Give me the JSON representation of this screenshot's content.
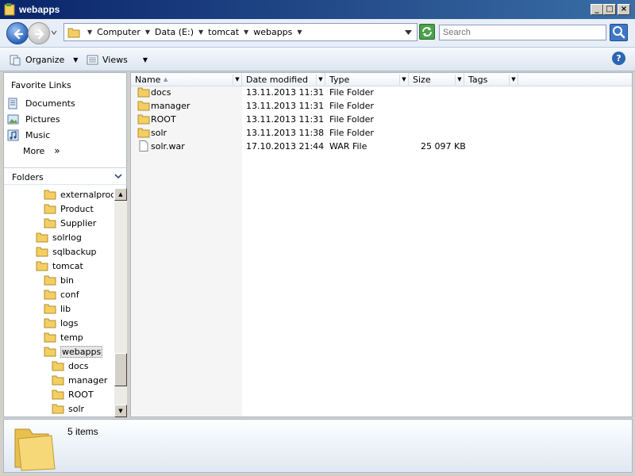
{
  "window": {
    "title": "webapps"
  },
  "address": {
    "crumbs": [
      "Computer",
      "Data (E:)",
      "tomcat",
      "webapps"
    ]
  },
  "search": {
    "placeholder": "Search"
  },
  "toolbar": {
    "organize_label": "Organize",
    "views_label": "Views"
  },
  "nav": {
    "favorites_title": "Favorite Links",
    "favorites": [
      {
        "label": "Documents",
        "icon": "documents-icon"
      },
      {
        "label": "Pictures",
        "icon": "pictures-icon"
      },
      {
        "label": "Music",
        "icon": "music-icon"
      },
      {
        "label": "More",
        "icon": "more-chevron-icon"
      }
    ],
    "folders_label": "Folders",
    "tree": [
      {
        "label": "externalprodu",
        "selected": false
      },
      {
        "label": "Product",
        "selected": false
      },
      {
        "label": "Supplier",
        "selected": false
      },
      {
        "label": "solrlog",
        "selected": false
      },
      {
        "label": "sqlbackup",
        "selected": false
      },
      {
        "label": "tomcat",
        "selected": false
      },
      {
        "label": "bin",
        "selected": false
      },
      {
        "label": "conf",
        "selected": false
      },
      {
        "label": "lib",
        "selected": false
      },
      {
        "label": "logs",
        "selected": false
      },
      {
        "label": "temp",
        "selected": false
      },
      {
        "label": "webapps",
        "selected": true
      },
      {
        "label": "docs",
        "selected": false
      },
      {
        "label": "manager",
        "selected": false
      },
      {
        "label": "ROOT",
        "selected": false
      },
      {
        "label": "solr",
        "selected": false
      }
    ]
  },
  "columns": {
    "name": "Name",
    "date": "Date modified",
    "type": "Type",
    "size": "Size",
    "tags": "Tags"
  },
  "files": [
    {
      "name": "docs",
      "date": "13.11.2013 11:31",
      "type": "File Folder",
      "size": "",
      "icon": "folder-icon"
    },
    {
      "name": "manager",
      "date": "13.11.2013 11:31",
      "type": "File Folder",
      "size": "",
      "icon": "folder-icon"
    },
    {
      "name": "ROOT",
      "date": "13.11.2013 11:31",
      "type": "File Folder",
      "size": "",
      "icon": "folder-icon"
    },
    {
      "name": "solr",
      "date": "13.11.2013 11:38",
      "type": "File Folder",
      "size": "",
      "icon": "folder-icon"
    },
    {
      "name": "solr.war",
      "date": "17.10.2013 21:44",
      "type": "WAR File",
      "size": "25 097 KB",
      "icon": "file-icon"
    }
  ],
  "status": {
    "count_text": "5 items"
  },
  "colors": {
    "title_bar": "#0a246a",
    "folder": "#f3cf63",
    "selection": "#e6e6e6"
  }
}
